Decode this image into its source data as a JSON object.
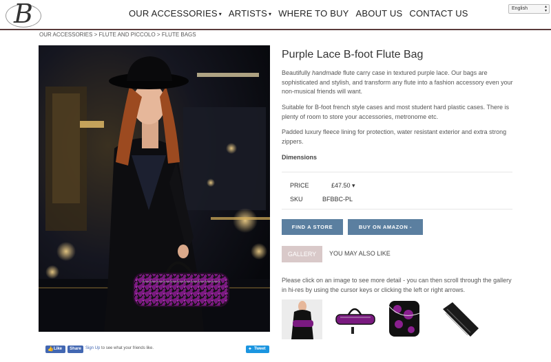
{
  "logo": {
    "letter": "B"
  },
  "nav": {
    "items": [
      {
        "label": "OUR ACCESSORIES",
        "dropdown": true
      },
      {
        "label": "ARTISTS",
        "dropdown": true
      },
      {
        "label": "WHERE TO BUY",
        "dropdown": false
      },
      {
        "label": "ABOUT US",
        "dropdown": false
      },
      {
        "label": "CONTACT US",
        "dropdown": false
      }
    ],
    "caret": "▾"
  },
  "language": {
    "selected": "English"
  },
  "breadcrumb": "OUR ACCESSORIES > FLUTE AND PICCOLO > FLUTE BAGS",
  "product": {
    "title": "Purple Lace B-foot Flute Bag",
    "desc1_pre": "Beautifully ",
    "desc1_em": "handmade",
    "desc1_post": " flute carry case in textured purple lace. Our bags are sophisticated and stylish, and transform any flute into a fashion accessory even your non-musical friends will want.",
    "desc2": "Suitable for B-foot french style cases and most student hard plastic cases. There is plenty of room to store your accessories, metronome etc.",
    "desc3": "Padded luxury fleece lining for protection, water resistant exterior and extra strong zippers.",
    "dimensions_label": "Dimensions",
    "price_label": "PRICE",
    "price_value": "£47.50 ▾",
    "sku_label": "SKU",
    "sku_value": "BFBBC-PL"
  },
  "buttons": {
    "find_store": "FIND A STORE",
    "buy_amazon": "BUY ON AMAZON -"
  },
  "tabs": {
    "gallery": "GALLERY",
    "also_like": "YOU MAY ALSO LIKE"
  },
  "gallery_text": "Please click on an image to see more detail - you can then scroll through the gallery in hi-res by using the cursor keys or clicking the left or right arrows.",
  "social": {
    "like": "Like",
    "share": "Share",
    "signup": "Sign Up",
    "signup_rest": " to see what your friends like.",
    "tweet": "Tweet"
  },
  "colors": {
    "header_rule": "#5a3a3a",
    "button": "#5b7fa0",
    "gallery_tab": "#d9c9c9",
    "bag_purple": "#8a1f8f",
    "facebook": "#4267b2",
    "twitter": "#1b95e0"
  },
  "icons": {
    "facebook": "facebook-thumb-icon",
    "twitter": "twitter-bird-icon"
  }
}
